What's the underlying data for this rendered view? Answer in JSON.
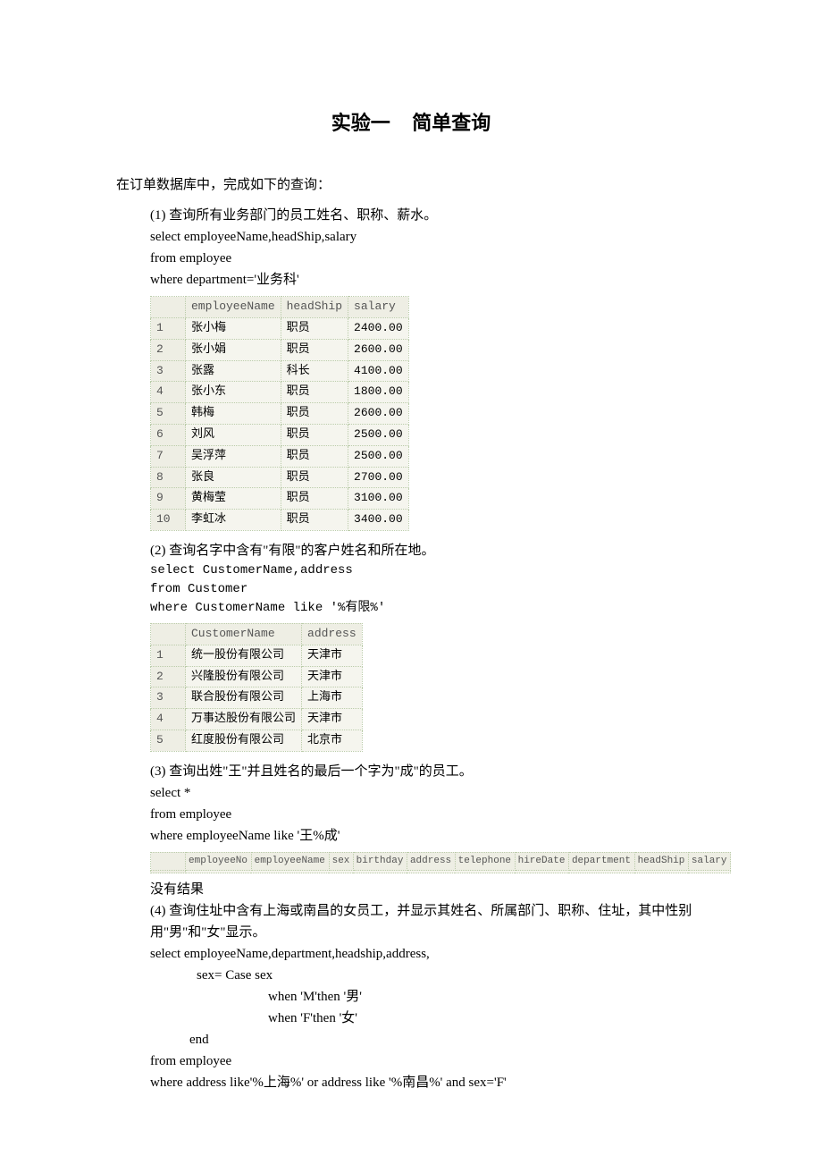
{
  "title": "实验一    简单查询",
  "intro": "在订单数据库中，完成如下的查询：",
  "q1": {
    "prompt": "(1) 查询所有业务部门的员工姓名、职称、薪水。",
    "sql1": "select employeeName,headShip,salary",
    "sql2": "from employee",
    "sql3": "where department='业务科'",
    "headers": [
      "employeeName",
      "headShip",
      "salary"
    ],
    "rows": [
      [
        "张小梅",
        "职员",
        "2400.00"
      ],
      [
        "张小娟",
        "职员",
        "2600.00"
      ],
      [
        "张露",
        "科长",
        "4100.00"
      ],
      [
        "张小东",
        "职员",
        "1800.00"
      ],
      [
        "韩梅",
        "职员",
        "2600.00"
      ],
      [
        "刘风",
        "职员",
        "2500.00"
      ],
      [
        "吴浮萍",
        "职员",
        "2500.00"
      ],
      [
        "张良",
        "职员",
        "2700.00"
      ],
      [
        "黄梅莹",
        "职员",
        "3100.00"
      ],
      [
        "李虹冰",
        "职员",
        "3400.00"
      ]
    ]
  },
  "q2": {
    "prompt": "(2) 查询名字中含有\"有限\"的客户姓名和所在地。",
    "sql1": "select CustomerName,address",
    "sql2": "from Customer",
    "sql3": "where CustomerName like '%有限%'",
    "headers": [
      "CustomerName",
      "address"
    ],
    "rows": [
      [
        "统一股份有限公司",
        "天津市"
      ],
      [
        "兴隆股份有限公司",
        "天津市"
      ],
      [
        "联合股份有限公司",
        "上海市"
      ],
      [
        "万事达股份有限公司",
        "天津市"
      ],
      [
        "红度股份有限公司",
        "北京市"
      ]
    ]
  },
  "q3": {
    "prompt": "(3) 查询出姓\"王\"并且姓名的最后一个字为\"成\"的员工。",
    "sql1": "select *",
    "sql2": "from employee",
    "sql3": "where employeeName like '王%成'",
    "headers": [
      "employeeNo",
      "employeeName",
      "sex",
      "birthday",
      "address",
      "telephone",
      "hireDate",
      "department",
      "headShip",
      "salary"
    ],
    "noresult": "没有结果"
  },
  "q4": {
    "prompt1": "(4) 查询住址中含有上海或南昌的女员工，并显示其姓名、所属部门、职称、住址，其中性别用\"男\"和\"女\"显示。",
    "sql1": "select employeeName,department,headship,address,",
    "sql2": "sex= Case sex",
    "sql3": "when 'M'then '男'",
    "sql4": " when 'F'then '女'",
    "sql5": "end",
    "sql6": "from    employee",
    "sql7": "where   address like'%上海%' or address like '%南昌%' and sex='F'"
  }
}
